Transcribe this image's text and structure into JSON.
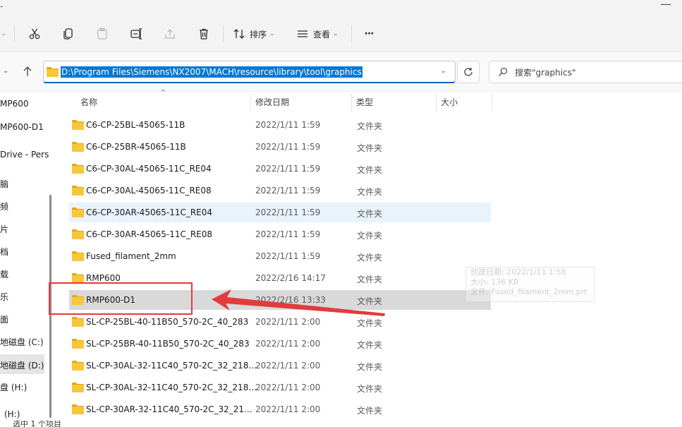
{
  "toolbar": {
    "sort_label": "排序",
    "view_label": "查看",
    "more_label": "···"
  },
  "address": {
    "path": "D:\\Program Files\\Siemens\\NX2007\\MACH\\resource\\library\\tool\\graphics"
  },
  "search": {
    "placeholder": "搜索\"graphics\""
  },
  "sidebar": {
    "items": [
      {
        "label": "MP600"
      },
      {
        "label": "MP600-D1"
      },
      {
        "label": "Drive - Pers"
      },
      {
        "label": "脑"
      },
      {
        "label": "频"
      },
      {
        "label": "片"
      },
      {
        "label": "档"
      },
      {
        "label": "载"
      },
      {
        "label": "乐"
      },
      {
        "label": "面"
      },
      {
        "label": "地磁盘 (C:)"
      },
      {
        "label": "地磁盘 (D:)"
      },
      {
        "label": "盘 (H:)"
      },
      {
        "label": "(H:)"
      }
    ]
  },
  "columns": {
    "name": "名称",
    "date": "修改日期",
    "type": "类型",
    "size": "大小"
  },
  "files": [
    {
      "name": "C6-CP-25BL-45065-11B",
      "date": "2022/1/11 1:59",
      "type": "文件夹"
    },
    {
      "name": "C6-CP-25BR-45065-11B",
      "date": "2022/1/11 1:59",
      "type": "文件夹"
    },
    {
      "name": "C6-CP-30AL-45065-11C_RE04",
      "date": "2022/1/11 1:59",
      "type": "文件夹"
    },
    {
      "name": "C6-CP-30AL-45065-11C_RE08",
      "date": "2022/1/11 1:59",
      "type": "文件夹"
    },
    {
      "name": "C6-CP-30AR-45065-11C_RE04",
      "date": "2022/1/11 1:59",
      "type": "文件夹"
    },
    {
      "name": "C6-CP-30AR-45065-11C_RE08",
      "date": "2022/1/11 1:59",
      "type": "文件夹"
    },
    {
      "name": "Fused_filament_2mm",
      "date": "2022/1/11 1:59",
      "type": "文件夹"
    },
    {
      "name": "RMP600",
      "date": "2022/2/16 14:17",
      "type": "文件夹"
    },
    {
      "name": "RMP600-D1",
      "date": "2022/2/16 13:33",
      "type": "文件夹"
    },
    {
      "name": "SL-CP-25BL-40-11B50_570-2C_40_283",
      "date": "2022/1/11 2:00",
      "type": "文件夹"
    },
    {
      "name": "SL-CP-25BR-40-11B50_570-2C_40_283",
      "date": "2022/1/11 2:00",
      "type": "文件夹"
    },
    {
      "name": "SL-CP-30AL-32-11C40_570-2C_32_218...",
      "date": "2022/1/11 2:00",
      "type": "文件夹"
    },
    {
      "name": "SL-CP-30AL-32-11C40_570-2C_32_218...",
      "date": "2022/1/11 2:00",
      "type": "文件夹"
    },
    {
      "name": "SL-CP-30AR-32-11C40_570-2C_32_21...",
      "date": "2022/1/11 2:00",
      "type": "文件夹"
    }
  ],
  "tooltip": {
    "line1": "创建日期: 2022/1/11 1:58",
    "line2": "大小: 136 KB",
    "line3": "文件: Fused_filament_2mm.prt"
  },
  "status": {
    "text": "选中 1 个项目"
  },
  "colors": {
    "accent": "#0078d4",
    "annotation": "#e23b3b",
    "folder": "#f8c63a"
  }
}
